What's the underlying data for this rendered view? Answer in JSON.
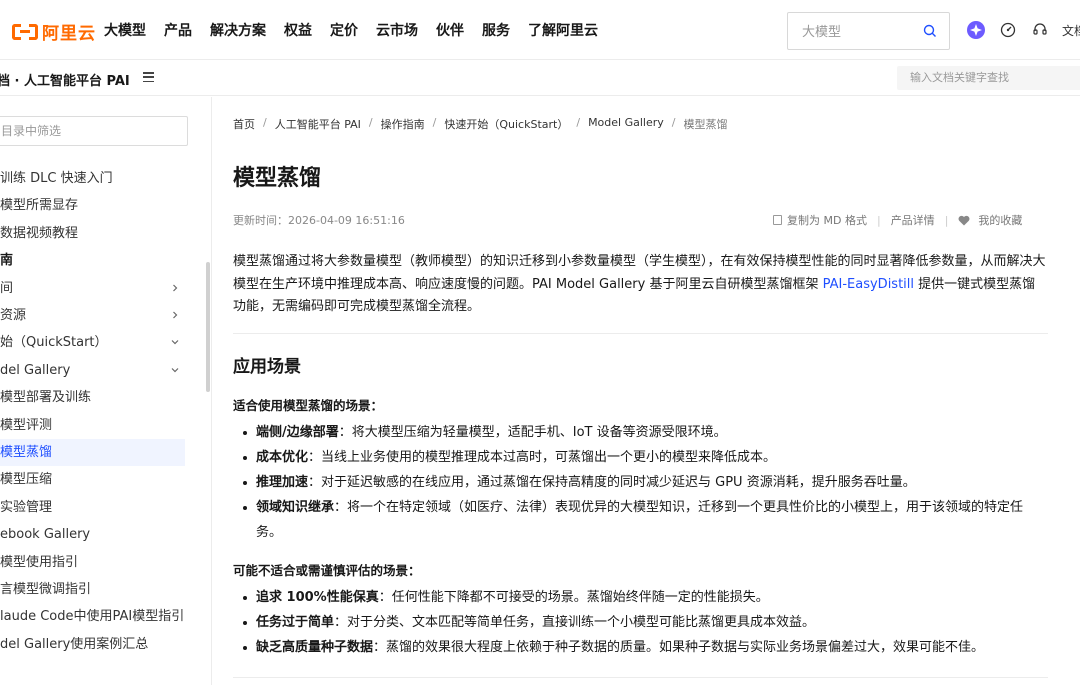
{
  "brand": {
    "name": "阿里云",
    "color": "#ff6a00"
  },
  "nav": {
    "items": [
      "大模型",
      "产品",
      "解决方案",
      "权益",
      "定价",
      "云市场",
      "伙伴",
      "服务",
      "了解阿里云"
    ]
  },
  "search": {
    "placeholder": "大模型"
  },
  "top_icons": [
    "ai-assistant-icon",
    "console-icon",
    "support-icon"
  ],
  "top_doc_link": "文档",
  "subbar": {
    "title": "档 · 人工智能平台 PAI",
    "doc_search_placeholder": "输入文档关键字查找"
  },
  "sidebar": {
    "filter_placeholder": "目录中筛选",
    "items": [
      {
        "label": "训练 DLC 快速入门",
        "chevron": ""
      },
      {
        "label": "模型所需显存",
        "chevron": ""
      },
      {
        "label": "数据视频教程",
        "chevron": ""
      },
      {
        "label": "南",
        "chevron": "",
        "section": true
      },
      {
        "label": "间",
        "chevron": "right"
      },
      {
        "label": "资源",
        "chevron": "right"
      },
      {
        "label": "始（QuickStart）",
        "chevron": "down"
      },
      {
        "label": "del Gallery",
        "chevron": "down"
      },
      {
        "label": "模型部署及训练",
        "chevron": ""
      },
      {
        "label": "模型评测",
        "chevron": ""
      },
      {
        "label": "模型蒸馏",
        "chevron": "",
        "active": true
      },
      {
        "label": "模型压缩",
        "chevron": ""
      },
      {
        "label": "实验管理",
        "chevron": ""
      },
      {
        "label": "ebook Gallery",
        "chevron": ""
      },
      {
        "label": "模型使用指引",
        "chevron": ""
      },
      {
        "label": "言模型微调指引",
        "chevron": ""
      },
      {
        "label": "laude Code中使用PAI模型指引",
        "chevron": ""
      },
      {
        "label": "del Gallery使用案例汇总",
        "chevron": ""
      }
    ]
  },
  "breadcrumb": [
    "首页",
    "人工智能平台 PAI",
    "操作指南",
    "快速开始（QuickStart）",
    "Model Gallery",
    "模型蒸馏"
  ],
  "page": {
    "title": "模型蒸馏",
    "updated": "更新时间：2026-04-09 16:51:16",
    "actions": {
      "copy_md": "复制为 MD 格式",
      "product_detail": "产品详情",
      "favorite": "我的收藏"
    },
    "intro_before_link": "模型蒸馏通过将大参数量模型（教师模型）的知识迁移到小参数量模型（学生模型），在有效保持模型性能的同时显著降低参数量，从而解决大模型在生产环境中推理成本高、响应速度慢的问题。PAI Model Gallery 基于阿里云自研模型蒸馏框架 ",
    "intro_link": "PAI-EasyDistill",
    "intro_after_link": " 提供一键式模型蒸馏功能，无需编码即可完成模型蒸馏全流程。",
    "section_title": "应用场景",
    "suitable": {
      "heading": "适合使用模型蒸馏的场景：",
      "items": [
        {
          "term": "端侧/边缘部署",
          "desc": "：将大模型压缩为轻量模型，适配手机、IoT 设备等资源受限环境。"
        },
        {
          "term": "成本优化",
          "desc": "：当线上业务使用的模型推理成本过高时，可蒸馏出一个更小的模型来降低成本。"
        },
        {
          "term": "推理加速",
          "desc": "：对于延迟敏感的在线应用，通过蒸馏在保持高精度的同时减少延迟与 GPU 资源消耗，提升服务吞吐量。"
        },
        {
          "term": "领域知识继承",
          "desc": "：将一个在特定领域（如医疗、法律）表现优异的大模型知识，迁移到一个更具性价比的小模型上，用于该领域的特定任务。"
        }
      ]
    },
    "unsuitable": {
      "heading": "可能不适合或需谨慎评估的场景：",
      "items": [
        {
          "term": "追求 100%性能保真",
          "desc": "：任何性能下降都不可接受的场景。蒸馏始终伴随一定的性能损失。"
        },
        {
          "term": "任务过于简单",
          "desc": "：对于分类、文本匹配等简单任务，直接训练一个小模型可能比蒸馏更具成本效益。"
        },
        {
          "term": "缺乏高质量种子数据",
          "desc": "：蒸馏的效果很大程度上依赖于种子数据的质量。如果种子数据与实际业务场景偏差过大，效果可能不佳。"
        }
      ]
    }
  },
  "colors": {
    "link": "#1f4fff",
    "active_bg": "#f0f4ff"
  }
}
